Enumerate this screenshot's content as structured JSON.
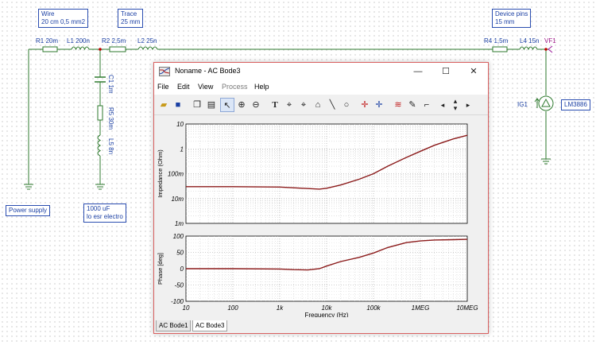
{
  "schematic": {
    "components": {
      "R1": "R1 20m",
      "L1": "L1 200n",
      "R2": "R2 2,5m",
      "L2": "L2 25n",
      "C1": "C1 1m",
      "R5": "R5 30m",
      "L5": "L5 8n",
      "R4": "R4 1,5m",
      "L4": "L4 15n",
      "VF1": "VF1",
      "IG1": "IG1"
    },
    "notes": {
      "wire": [
        "Wire",
        "20 cm 0,5 mm2"
      ],
      "trace": [
        "Trace",
        "25 mm"
      ],
      "device_pins": [
        "Device pins",
        "15 mm"
      ],
      "power_supply": "Power supply",
      "electro": [
        "1000 uF",
        "lo esr electro"
      ],
      "lm3886": "LM3886"
    },
    "colors": {
      "wire": "#2e7a2e",
      "resistor": "#2e7a2e",
      "label": "#1a3fa3",
      "node": "#c00000"
    }
  },
  "window": {
    "title": "Noname - AC Bode3",
    "icon": "bode-plot-icon",
    "controls": {
      "minimize": "—",
      "maximize": "☐",
      "close": "✕"
    },
    "menu": [
      {
        "label": "File",
        "enabled": true
      },
      {
        "label": "Edit",
        "enabled": true
      },
      {
        "label": "View",
        "enabled": true
      },
      {
        "label": "Process",
        "enabled": false
      },
      {
        "label": "Help",
        "enabled": true
      }
    ],
    "toolbar": [
      "open-icon",
      "save-icon",
      "copy-icon",
      "paste-icon",
      "pointer-icon",
      "zoom-in-icon",
      "zoom-out-icon",
      "text-icon",
      "cursor-a-icon",
      "cursor-b-icon",
      "label-icon",
      "line-icon",
      "ellipse-icon",
      "marker-icon",
      "marker2-icon",
      "curve-icon",
      "pen-icon",
      "step-icon",
      "left-icon",
      "updown-icon",
      "right-icon"
    ],
    "tabs": [
      {
        "label": "AC Bode1",
        "active": false
      },
      {
        "label": "AC Bode3",
        "active": true
      }
    ]
  },
  "chart_data": [
    {
      "type": "line",
      "ylabel": "Impedance (Ohm)",
      "yscale": "log",
      "xscale": "log",
      "ylim": [
        0.001,
        10
      ],
      "xlim": [
        10,
        10000000
      ],
      "yticks": [
        "1m",
        "10m",
        "100m",
        "1",
        "10"
      ],
      "grid": true,
      "color": "#8b1a1a",
      "x": [
        10,
        100,
        1000,
        3000,
        7000,
        10000,
        20000,
        50000,
        100000,
        200000,
        500000,
        1000000,
        2000000,
        5000000,
        10000000
      ],
      "y": [
        0.03,
        0.03,
        0.029,
        0.026,
        0.024,
        0.026,
        0.035,
        0.06,
        0.1,
        0.2,
        0.45,
        0.8,
        1.4,
        2.5,
        3.5
      ]
    },
    {
      "type": "line",
      "ylabel": "Phase [deg]",
      "xlabel": "Frequency (Hz)",
      "xscale": "log",
      "ylim": [
        -100,
        100
      ],
      "xlim": [
        10,
        10000000
      ],
      "yticks": [
        "-100",
        "-50",
        "0",
        "50",
        "100"
      ],
      "xticks": [
        "10",
        "100",
        "1k",
        "10k",
        "100k",
        "1MEG",
        "10MEG"
      ],
      "grid": true,
      "color": "#8b1a1a",
      "x": [
        10,
        100,
        1000,
        2000,
        4000,
        7000,
        10000,
        20000,
        50000,
        100000,
        200000,
        500000,
        1000000,
        2000000,
        5000000,
        10000000
      ],
      "y": [
        0,
        0,
        -1,
        -3,
        -4,
        0,
        8,
        22,
        35,
        48,
        65,
        80,
        85,
        88,
        89,
        90
      ]
    }
  ]
}
